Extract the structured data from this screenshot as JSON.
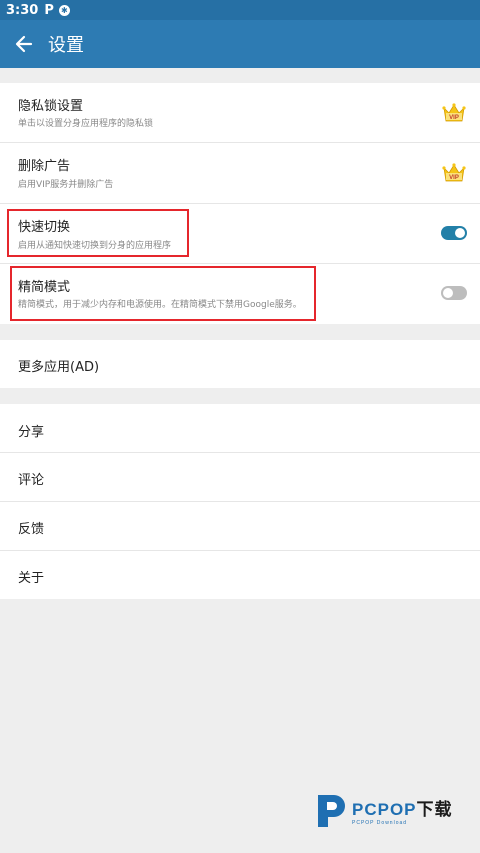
{
  "status_bar": {
    "time": "3:30",
    "app_icon": "P"
  },
  "app_bar": {
    "title": "设置"
  },
  "sections": {
    "privacy": {
      "title": "隐私锁设置",
      "subtitle": "单击以设置分身应用程序的隐私锁",
      "badge": "VIP"
    },
    "remove_ads": {
      "title": "删除广告",
      "subtitle": "启用VIP服务并删除广告",
      "badge": "VIP"
    },
    "quick_switch": {
      "title": "快速切换",
      "subtitle": "启用从通知快速切换到分身的应用程序",
      "enabled": true
    },
    "lite_mode": {
      "title": "精简模式",
      "subtitle": "精简模式，用于减少内存和电源使用。在精简模式下禁用Google服务。",
      "enabled": false
    },
    "more_apps": {
      "title": "更多应用(AD)"
    },
    "share": {
      "title": "分享"
    },
    "review": {
      "title": "评论"
    },
    "feedback": {
      "title": "反馈"
    },
    "about": {
      "title": "关于"
    }
  },
  "watermark": {
    "brand": "PCPOP",
    "brand_cn": "下载",
    "sub": "PCPOP Download"
  },
  "colors": {
    "status_bar": "#2670a5",
    "app_bar": "#2d7bb3",
    "toggle_on": "#2380a8",
    "toggle_off": "#bdbdbd",
    "highlight_box": "#e5262c"
  }
}
